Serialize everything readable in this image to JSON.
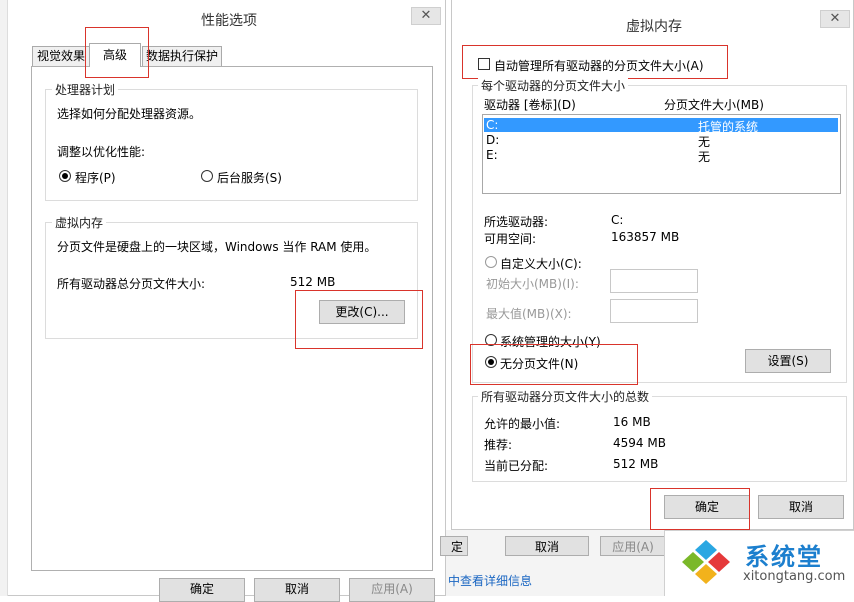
{
  "perf": {
    "title": "性能选项",
    "close": "✕",
    "tabs": [
      "视觉效果",
      "高级",
      "数据执行保护"
    ],
    "processor": {
      "legend": "处理器计划",
      "desc": "选择如何分配处理器资源。",
      "adjust": "调整以优化性能:",
      "opt_programs": "程序(P)",
      "opt_background": "后台服务(S)"
    },
    "vm": {
      "legend": "虚拟内存",
      "desc": "分页文件是硬盘上的一块区域，Windows 当作 RAM 使用。",
      "total_label": "所有驱动器总分页文件大小:",
      "total_value": "512 MB",
      "change_button": "更改(C)..."
    },
    "buttons": {
      "ok": "确定",
      "cancel": "取消",
      "apply": "应用(A)"
    }
  },
  "virtual": {
    "title": "虚拟内存",
    "close": "✕",
    "auto_manage": "自动管理所有驱动器的分页文件大小(A)",
    "per_drive_legend": "每个驱动器的分页文件大小",
    "col_drive": "驱动器 [卷标](D)",
    "col_size": "分页文件大小(MB)",
    "drives": [
      {
        "drive": "C:",
        "size": "托管的系统"
      },
      {
        "drive": "D:",
        "size": "无"
      },
      {
        "drive": "E:",
        "size": "无"
      }
    ],
    "selected_label": "所选驱动器:",
    "selected_value": "C:",
    "free_label": "可用空间:",
    "free_value": "163857 MB",
    "custom_size": "自定义大小(C):",
    "initial_size": "初始大小(MB)(I):",
    "max_size": "最大值(MB)(X):",
    "system_managed": "系统管理的大小(Y)",
    "no_paging": "无分页文件(N)",
    "set_button": "设置(S)",
    "totals_legend": "所有驱动器分页文件大小的总数",
    "min_label": "允许的最小值:",
    "min_value": "16 MB",
    "rec_label": "推荐:",
    "rec_value": "4594 MB",
    "cur_label": "当前已分配:",
    "cur_value": "512 MB",
    "ok": "确定",
    "cancel": "取消"
  },
  "behind": {
    "ok_partial": "定",
    "cancel": "取消",
    "apply": "应用(A)",
    "link": "中查看详细信息"
  },
  "watermark": {
    "brand": "系统堂",
    "url": "xitongtang.com"
  }
}
